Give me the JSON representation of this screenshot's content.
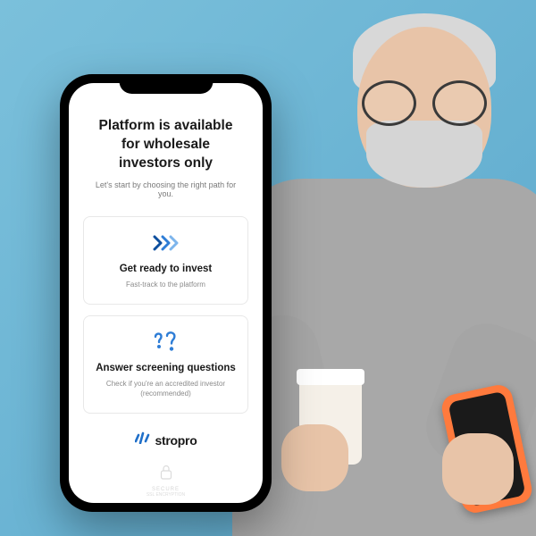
{
  "page": {
    "title": "Platform is available for wholesale investors only",
    "subtitle": "Let's start by choosing the right path for you."
  },
  "cards": [
    {
      "icon": "chevrons-right",
      "title": "Get ready to invest",
      "subtitle": "Fast-track to the platform"
    },
    {
      "icon": "question-marks",
      "title": "Answer screening questions",
      "subtitle": "Check if you're an accredited investor (recommended)"
    }
  ],
  "brand": {
    "name": "stropro"
  },
  "secure": {
    "label": "SECURE",
    "sublabel": "SSL ENCRYPTION"
  }
}
